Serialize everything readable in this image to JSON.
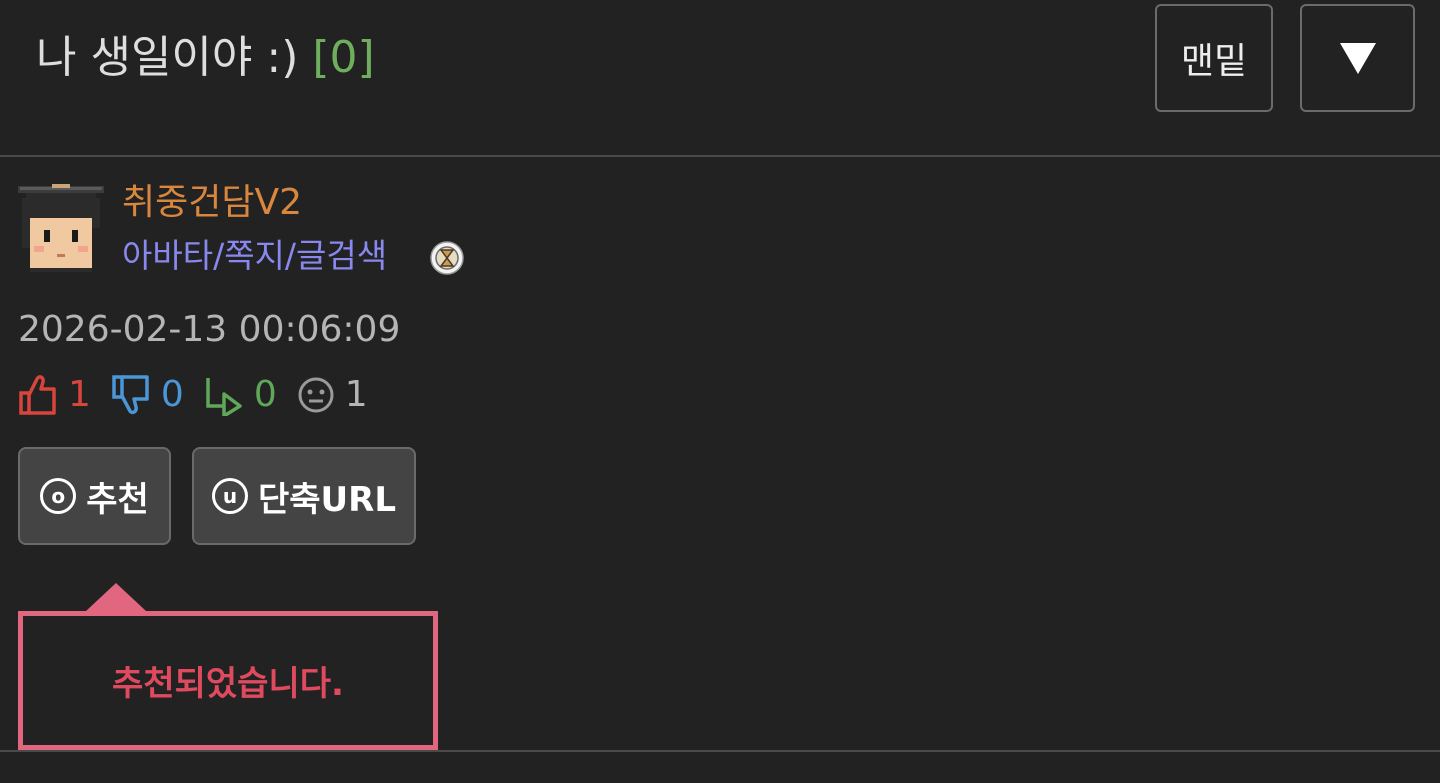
{
  "header": {
    "title": "나 생일이야 :)",
    "comment_count": "[0]",
    "bottom_button_label": "맨밑",
    "down_button_label": "▼"
  },
  "author": {
    "nickname": "취중건담V2",
    "links": "아바타/쪽지/글검색",
    "avatar_icon": "graduate-avatar-icon",
    "badge_icon": "hourglass-badge-icon"
  },
  "post": {
    "date": "2026-02-13 00:06:09"
  },
  "stats": {
    "likes": "1",
    "dislikes": "0",
    "replies": "0",
    "views": "1"
  },
  "actions": {
    "recommend_key": "o",
    "recommend_label": "추천",
    "shorturl_key": "u",
    "shorturl_label": "단축URL"
  },
  "toast": {
    "message": "추천되었습니다."
  },
  "colors": {
    "background": "#222222",
    "title_text": "#dedede",
    "comment_count": "#6fae5c",
    "nickname": "#d9873e",
    "links": "#8888ee",
    "like": "#d8453d",
    "dislike": "#4a96d6",
    "reply": "#5fa85a",
    "toast_border": "#e0677f",
    "toast_text": "#e04a5f"
  }
}
